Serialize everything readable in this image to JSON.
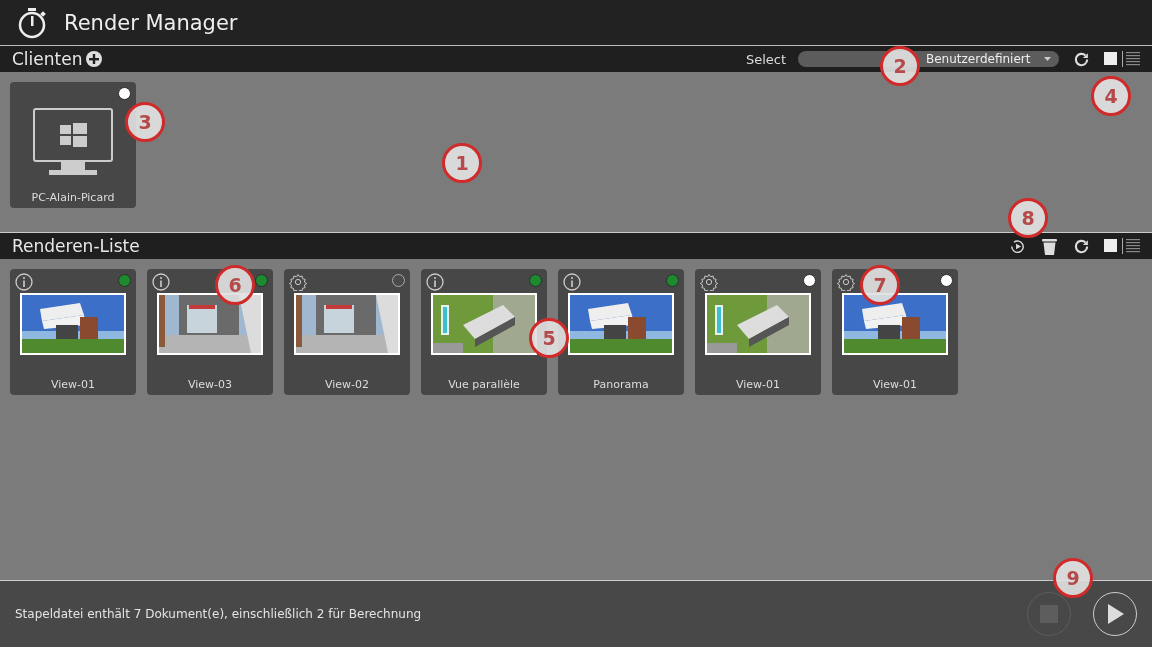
{
  "window": {
    "title": "Render Manager"
  },
  "clients": {
    "title": "Clienten",
    "select_label": "Select",
    "select_value": "Benutzerdefiniert",
    "view_toggle": [
      {
        "kind": "grid",
        "selected": true
      },
      {
        "kind": "list",
        "selected": false
      }
    ],
    "items": [
      {
        "name": "PC-Alain-Picard",
        "color": "#ffffff"
      }
    ]
  },
  "render_list": {
    "title": "Renderen-Liste",
    "view_toggle": [
      {
        "kind": "grid",
        "selected": true
      },
      {
        "kind": "list",
        "selected": false
      }
    ],
    "items": [
      {
        "name": "View-01",
        "kind": "info",
        "color": "#1e8a2e"
      },
      {
        "name": "View-03",
        "kind": "info",
        "color": "#1e8a2e"
      },
      {
        "name": "View-02",
        "kind": "settings",
        "color": "#4a4a4a"
      },
      {
        "name": "Vue parallèle",
        "kind": "info",
        "color": "#1e8a2e"
      },
      {
        "name": "Panorama",
        "kind": "info",
        "color": "#1e8a2e"
      },
      {
        "name": "View-01",
        "kind": "settings",
        "color": "#ffffff"
      },
      {
        "name": "View-01",
        "kind": "settings",
        "color": "#ffffff"
      }
    ]
  },
  "status_bar": {
    "text": "Stapeldatei enthält 7 Dokument(e), einschließlich 2 für Berechnung",
    "stop_disabled": true,
    "play_disabled": false
  },
  "callouts": [
    "1",
    "2",
    "3",
    "4",
    "5",
    "6",
    "7",
    "8",
    "9"
  ]
}
